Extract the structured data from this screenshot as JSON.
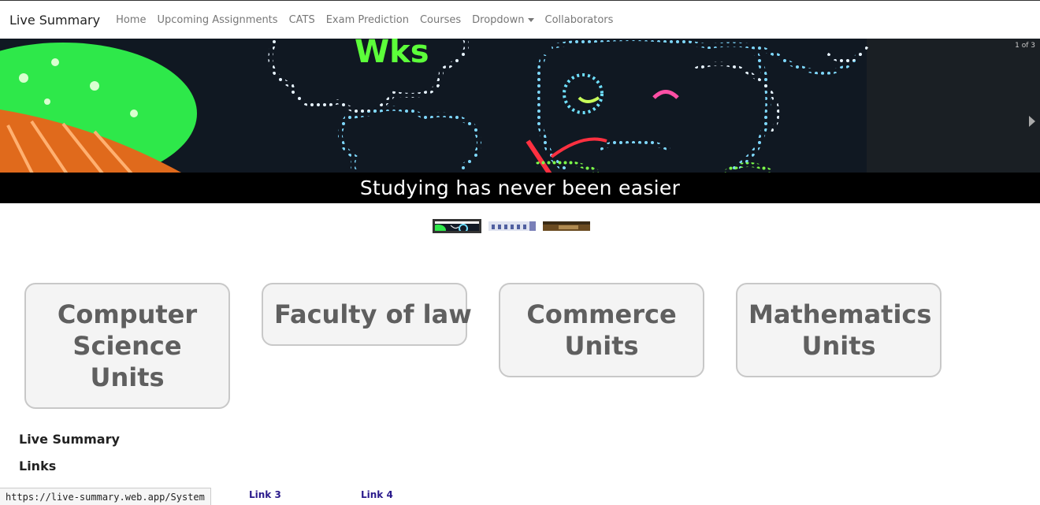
{
  "navbar": {
    "brand": "Live Summary",
    "links": [
      "Home",
      "Upcoming Assignments",
      "CATS",
      "Exam Prediction",
      "Courses",
      "Dropdown",
      "Collaborators"
    ]
  },
  "carousel": {
    "counter": "1 of 3",
    "caption": "Studying has never been easier",
    "sign_text": "Wks",
    "thumbnails": [
      "slide-1",
      "slide-2",
      "slide-3"
    ],
    "active_index": 0
  },
  "units": [
    {
      "line1": "Computer",
      "line2": "Science Units"
    },
    {
      "line1": "Faculty of law",
      "line2": ""
    },
    {
      "line1": "Commerce",
      "line2": "Units"
    },
    {
      "line1": "Mathematics",
      "line2": "Units"
    }
  ],
  "footer": {
    "title": "Live Summary",
    "links_title": "Links",
    "link3": "Link 3",
    "link4": "Link 4"
  },
  "status_bar": {
    "url": "https://live-summary.web.app/System"
  },
  "colors": {
    "card_bg": "#f4f4f4",
    "card_text": "#5f5f5f",
    "link": "#2a1a8c"
  }
}
